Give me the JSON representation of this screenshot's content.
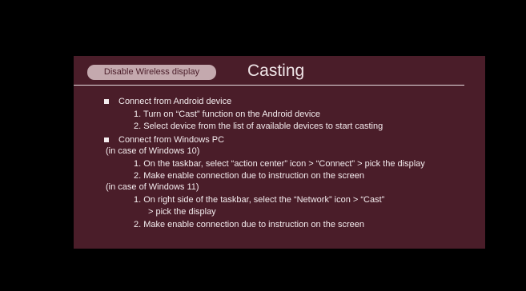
{
  "slide": {
    "disable_button": "Disable Wireless display",
    "title": "Casting",
    "sections": [
      {
        "heading": "Connect from Android device",
        "steps": [
          "1.  Turn on “Cast” function on the Android device",
          "2.  Select device from the list of available devices to start casting"
        ]
      },
      {
        "heading": "Connect from Windows PC",
        "win10_label": "(in case of Windows 10)",
        "win10_steps": [
          "1.  On the taskbar, select “action center” icon > “Connect” > pick the display",
          "2.  Make enable connection due to instruction on the screen"
        ],
        "win11_label": "(in case of Windows 11)",
        "win11_steps": [
          "1.  On right side of the taskbar, select the “Network” icon > “Cast”",
          "> pick the display",
          "2.  Make enable connection due to instruction on the screen"
        ]
      }
    ]
  },
  "colors": {
    "background": "#000000",
    "panel": "#4a1d29",
    "button": "#c4a9ae",
    "text": "#f4ecee"
  }
}
